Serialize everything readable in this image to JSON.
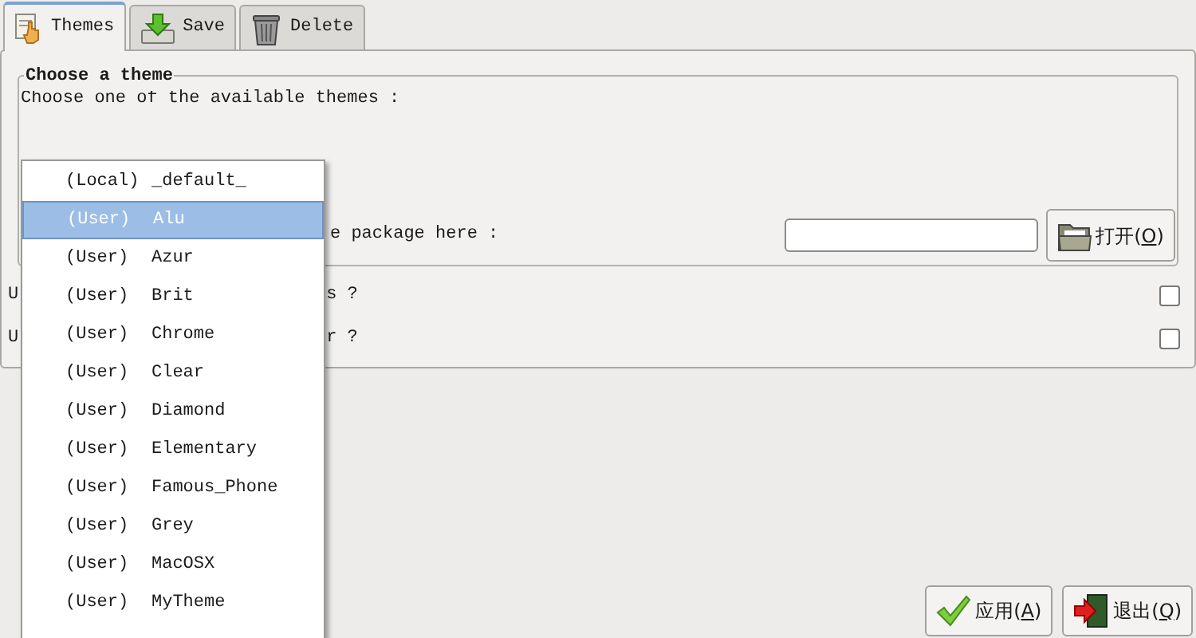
{
  "tabs": [
    {
      "label": "Themes",
      "kind": "hand",
      "selected": true
    },
    {
      "label": "Save",
      "kind": "save",
      "selected": false
    },
    {
      "label": "Delete",
      "kind": "trash",
      "selected": false
    }
  ],
  "group": {
    "title": "Choose a theme",
    "description": "Choose one of the available themes :",
    "package_label": "e package here :",
    "open_button": {
      "prefix": "打开(",
      "key": "O",
      "suffix": ")"
    }
  },
  "options": [
    {
      "left": "U",
      "right": "s ?",
      "checked": false
    },
    {
      "left": "U",
      "right": "r ?",
      "checked": false
    }
  ],
  "theme_list": [
    {
      "source": "(Local)",
      "name": "_default_",
      "selected": false
    },
    {
      "source": "(User)",
      "name": "Alu",
      "selected": true
    },
    {
      "source": "(User)",
      "name": "Azur",
      "selected": false
    },
    {
      "source": "(User)",
      "name": "Brit",
      "selected": false
    },
    {
      "source": "(User)",
      "name": "Chrome",
      "selected": false
    },
    {
      "source": "(User)",
      "name": "Clear",
      "selected": false
    },
    {
      "source": "(User)",
      "name": "Diamond",
      "selected": false
    },
    {
      "source": "(User)",
      "name": "Elementary",
      "selected": false
    },
    {
      "source": "(User)",
      "name": "Famous_Phone",
      "selected": false
    },
    {
      "source": "(User)",
      "name": "Grey",
      "selected": false
    },
    {
      "source": "(User)",
      "name": "MacOSX",
      "selected": false
    },
    {
      "source": "(User)",
      "name": "MyTheme",
      "selected": false
    }
  ],
  "buttons": [
    {
      "kind": "apply",
      "prefix": "应用(",
      "key": "A",
      "suffix": ")"
    },
    {
      "kind": "quit",
      "prefix": "退出(",
      "key": "Q",
      "suffix": ")"
    }
  ]
}
